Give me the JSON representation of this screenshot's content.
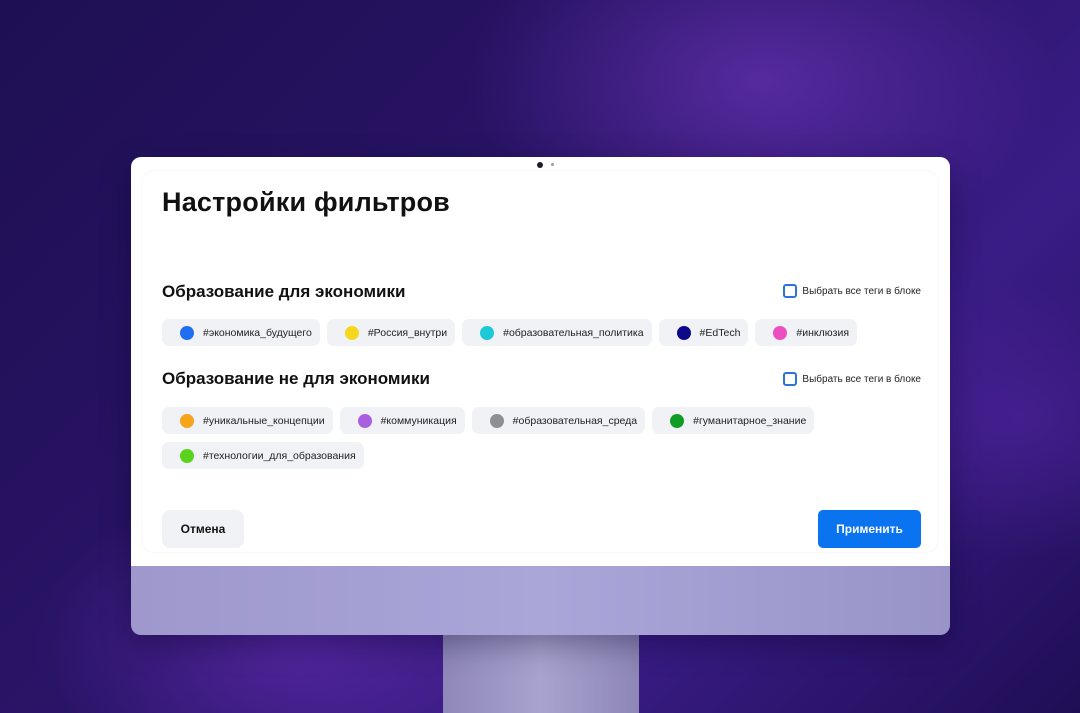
{
  "dialog": {
    "title": "Настройки фильтров",
    "cancel_label": "Отмена",
    "apply_label": "Применить"
  },
  "blocks": [
    {
      "title": "Образование для экономики",
      "select_all_label": "Выбрать все теги в блоке",
      "tags": [
        {
          "label": "#экономика_будущего",
          "color": "#1f6ff0"
        },
        {
          "label": "#Россия_внутри",
          "color": "#f5d81e"
        },
        {
          "label": "#образовательная_политика",
          "color": "#1cc9d6"
        },
        {
          "label": "#EdTech",
          "color": "#0d0a8a"
        },
        {
          "label": "#инклюзия",
          "color": "#ec4fc0"
        }
      ]
    },
    {
      "title": "Образование не для экономики",
      "select_all_label": "Выбрать все теги в блоке",
      "tags": [
        {
          "label": "#уникальные_концепции",
          "color": "#f4a51c"
        },
        {
          "label": "#коммуникация",
          "color": "#a960e0"
        },
        {
          "label": "#образовательная_среда",
          "color": "#8e8e94"
        },
        {
          "label": "#гуманитарное_знание",
          "color": "#129c25"
        },
        {
          "label": "#технологии_для_образования",
          "color": "#5bd21c"
        }
      ]
    }
  ]
}
